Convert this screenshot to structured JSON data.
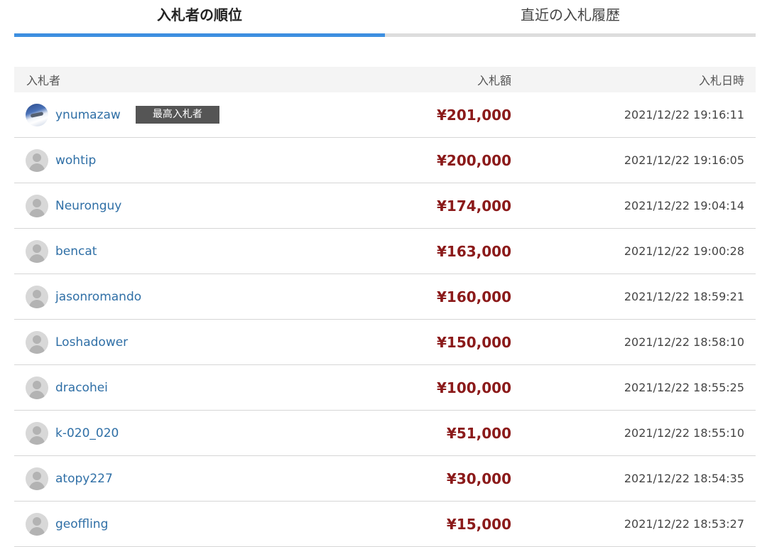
{
  "tabs": {
    "ranking": "入札者の順位",
    "history": "直近の入札履歴"
  },
  "table": {
    "headers": {
      "bidder": "入札者",
      "amount": "入札額",
      "datetime": "入札日時"
    },
    "top_bidder_badge": "最高入札者",
    "rows": [
      {
        "bidder": "ynumazaw",
        "amount": "¥201,000",
        "datetime": "2021/12/22 19:16:11",
        "avatar": "photo-airplane"
      },
      {
        "bidder": "wohtip",
        "amount": "¥200,000",
        "datetime": "2021/12/22 19:16:05",
        "avatar": "default-user-icon"
      },
      {
        "bidder": "Neuronguy",
        "amount": "¥174,000",
        "datetime": "2021/12/22 19:04:14",
        "avatar": "default-user-icon"
      },
      {
        "bidder": "bencat",
        "amount": "¥163,000",
        "datetime": "2021/12/22 19:00:28",
        "avatar": "default-user-icon"
      },
      {
        "bidder": "jasonromando",
        "amount": "¥160,000",
        "datetime": "2021/12/22 18:59:21",
        "avatar": "default-user-icon"
      },
      {
        "bidder": "Loshadower",
        "amount": "¥150,000",
        "datetime": "2021/12/22 18:58:10",
        "avatar": "default-user-icon"
      },
      {
        "bidder": "dracohei",
        "amount": "¥100,000",
        "datetime": "2021/12/22 18:55:25",
        "avatar": "default-user-icon"
      },
      {
        "bidder": "k-020_020",
        "amount": "¥51,000",
        "datetime": "2021/12/22 18:55:10",
        "avatar": "default-user-icon"
      },
      {
        "bidder": "atopy227",
        "amount": "¥30,000",
        "datetime": "2021/12/22 18:54:35",
        "avatar": "default-user-icon"
      },
      {
        "bidder": "geoffling",
        "amount": "¥15,000",
        "datetime": "2021/12/22 18:53:27",
        "avatar": "default-user-icon"
      }
    ]
  },
  "colors": {
    "active_tab_underline": "#3d8fe0",
    "amount": "#8b1a1a",
    "bidder_link": "#2f6fa6",
    "badge_bg": "#555555"
  }
}
